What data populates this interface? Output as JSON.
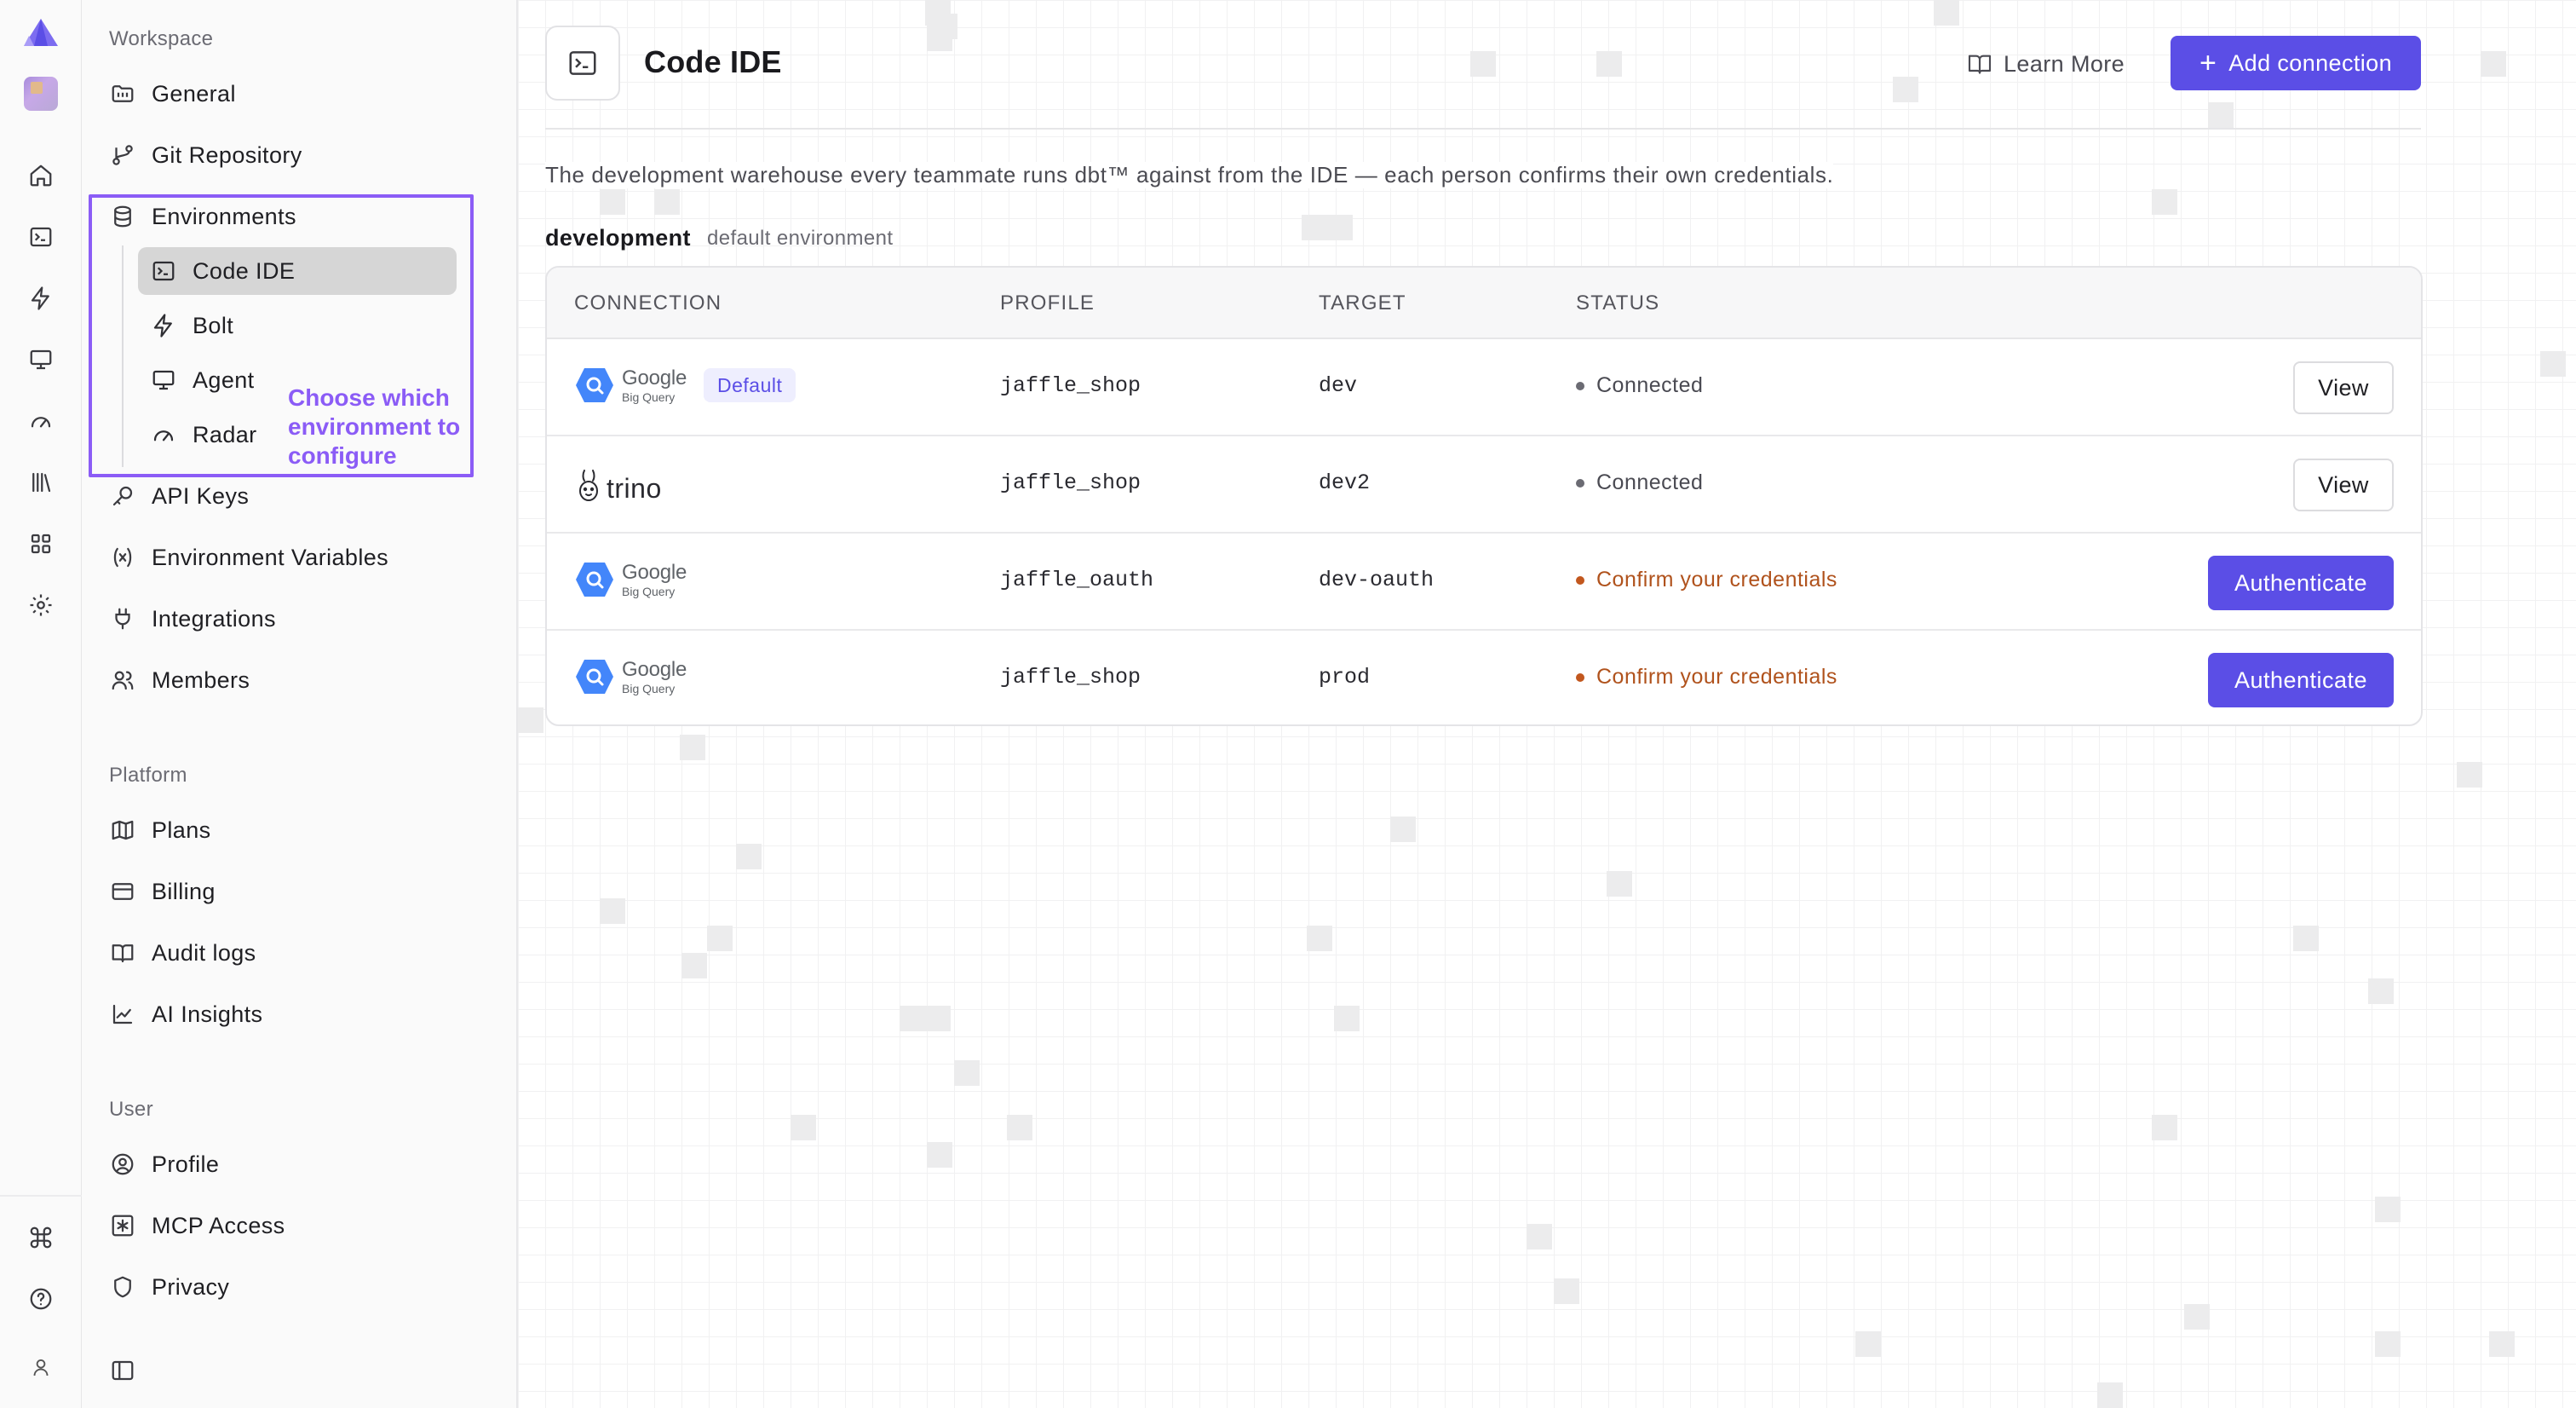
{
  "rail": {
    "items": [
      {
        "icon": "home-icon"
      },
      {
        "icon": "terminal-icon"
      },
      {
        "icon": "bolt-icon"
      },
      {
        "icon": "monitor-icon"
      },
      {
        "icon": "gauge-icon"
      },
      {
        "icon": "library-icon"
      },
      {
        "icon": "grid-icon"
      },
      {
        "icon": "settings-icon"
      }
    ],
    "bottom": [
      {
        "icon": "command-icon"
      },
      {
        "icon": "help-icon"
      },
      {
        "icon": "user-avatar-icon"
      }
    ]
  },
  "sidebar": {
    "workspace_label": "Workspace",
    "workspace_items": {
      "general": "General",
      "git": "Git Repository",
      "environments": "Environments",
      "api_keys": "API Keys",
      "env_vars": "Environment Variables",
      "integrations": "Integrations",
      "members": "Members"
    },
    "env_children": {
      "code_ide": "Code IDE",
      "bolt": "Bolt",
      "agent": "Agent",
      "radar": "Radar"
    },
    "annotation": "Choose which environment to configure",
    "platform_label": "Platform",
    "platform_items": {
      "plans": "Plans",
      "billing": "Billing",
      "audit": "Audit logs",
      "ai": "AI Insights"
    },
    "user_label": "User",
    "user_items": {
      "profile": "Profile",
      "mcp": "MCP Access",
      "privacy": "Privacy"
    }
  },
  "header": {
    "title": "Code IDE",
    "learn_more": "Learn More",
    "add_connection": "Add connection"
  },
  "description": "The development warehouse every teammate runs dbt™ against from the IDE — each person confirms their own credentials.",
  "environment": {
    "name": "development",
    "subtitle": "default environment"
  },
  "table": {
    "columns": {
      "connection": "CONNECTION",
      "profile": "PROFILE",
      "target": "TARGET",
      "status": "STATUS"
    },
    "rows": [
      {
        "connection": "Google Big Query",
        "logo_word": "Google",
        "logo_sub": "Big Query",
        "badge": "Default",
        "profile": "jaffle_shop",
        "target": "dev",
        "status": "Connected",
        "action": "View"
      },
      {
        "connection": "trino",
        "logo_word": "trino",
        "profile": "jaffle_shop",
        "target": "dev2",
        "status": "Connected",
        "action": "View"
      },
      {
        "connection": "Google Big Query",
        "logo_word": "Google",
        "logo_sub": "Big Query",
        "profile": "jaffle_oauth",
        "target": "dev-oauth",
        "status": "Confirm your credentials",
        "action": "Authenticate"
      },
      {
        "connection": "Google Big Query",
        "logo_word": "Google",
        "logo_sub": "Big Query",
        "profile": "jaffle_shop",
        "target": "prod",
        "status": "Confirm your credentials",
        "action": "Authenticate"
      }
    ]
  },
  "colors": {
    "accent": "#5b4ee6",
    "annotation": "#8b5cf6",
    "warning": "#b0521c"
  }
}
